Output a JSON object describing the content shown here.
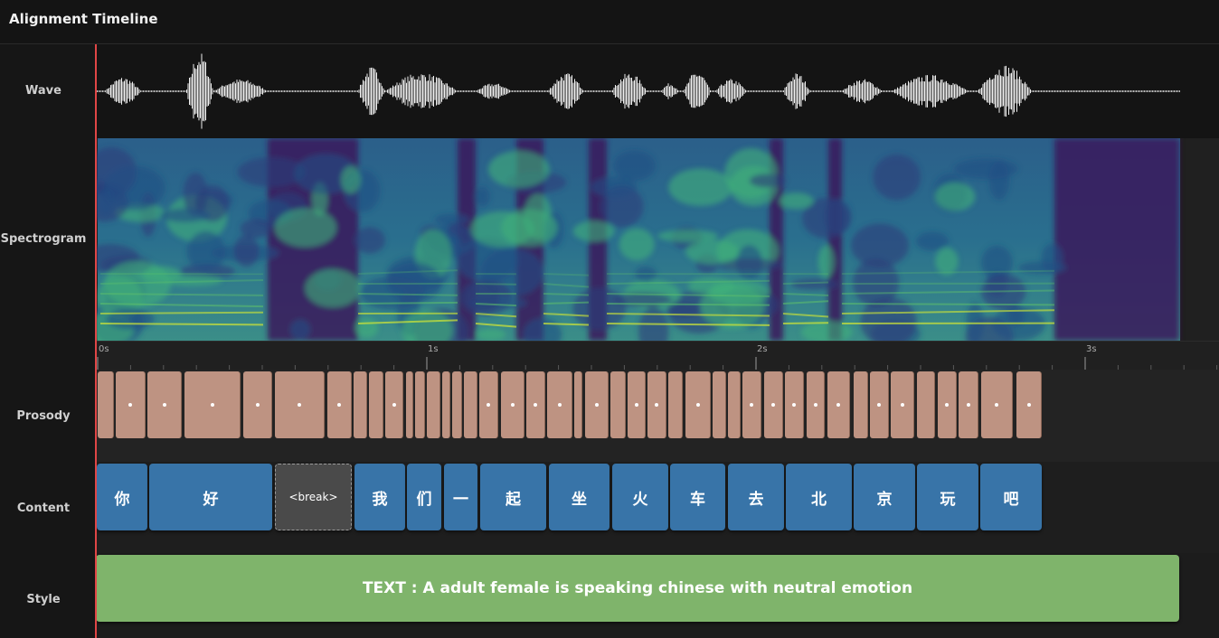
{
  "header": {
    "title": "Alignment Timeline"
  },
  "rows": {
    "wave": "Wave",
    "spectrogram": "Spectrogram",
    "prosody": "Prosody",
    "content": "Content",
    "style": "Style"
  },
  "ruler": {
    "ticks": [
      "0s",
      "1s",
      "2s",
      "3s"
    ]
  },
  "content_tokens": [
    "你",
    "好",
    "<break>",
    "我",
    "们",
    "一",
    "起",
    "坐",
    "火",
    "车",
    "去",
    "北",
    "京",
    "玩",
    "吧"
  ],
  "style_text": "TEXT : A adult female is speaking chinese with neutral emotion",
  "colors": {
    "prosody": "#be9382",
    "content": "#3874a8",
    "break": "#4a4a4a",
    "style": "#7fb46b",
    "playhead": "#e04646"
  }
}
